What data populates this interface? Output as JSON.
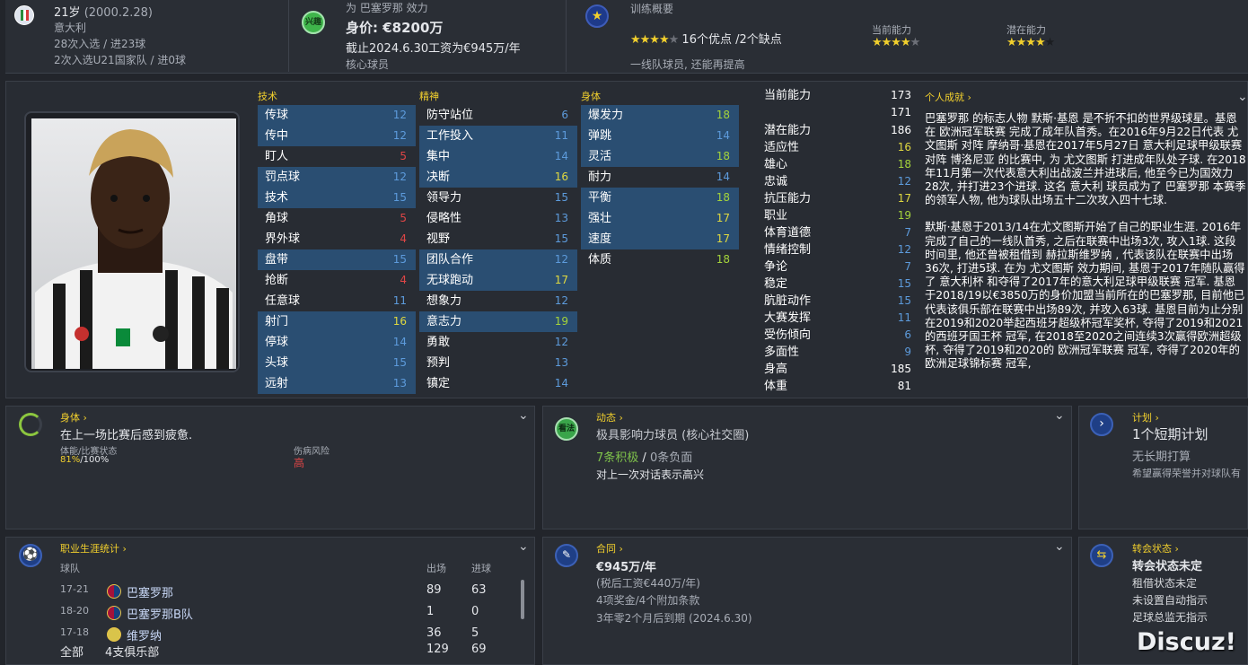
{
  "header": {
    "age": "21岁",
    "dob": "(2000.2.28)",
    "nation": "意大利",
    "caps": "28次入选 / 进23球",
    "u21": "2次入选U21国家队 / 进0球",
    "club_line": "为 巴塞罗那 效力",
    "club_icon_text": "兴趣",
    "value": "身价: €8200万",
    "wage_line": "截止2024.6.30工资为€945万/年",
    "role": "核心球员",
    "training_title": "训练概要",
    "training_summary": "16个优点 /2个缺点",
    "training_note": "一线队球员, 还能再提高",
    "ca_label": "当前能力",
    "pa_label": "潜在能力"
  },
  "attributes": {
    "tech_title": "技术",
    "mental_title": "精神",
    "physical_title": "身体",
    "technical": [
      {
        "name": "传球",
        "value": "12"
      },
      {
        "name": "传中",
        "value": "12"
      },
      {
        "name": "盯人",
        "value": "5"
      },
      {
        "name": "罚点球",
        "value": "12"
      },
      {
        "name": "技术",
        "value": "15"
      },
      {
        "name": "角球",
        "value": "5"
      },
      {
        "name": "界外球",
        "value": "4"
      },
      {
        "name": "盘带",
        "value": "15"
      },
      {
        "name": "抢断",
        "value": "4"
      },
      {
        "name": "任意球",
        "value": "11"
      },
      {
        "name": "射门",
        "value": "16"
      },
      {
        "name": "停球",
        "value": "14"
      },
      {
        "name": "头球",
        "value": "15"
      },
      {
        "name": "远射",
        "value": "13"
      }
    ],
    "mental": [
      {
        "name": "防守站位",
        "value": "6"
      },
      {
        "name": "工作投入",
        "value": "11"
      },
      {
        "name": "集中",
        "value": "14"
      },
      {
        "name": "决断",
        "value": "16"
      },
      {
        "name": "领导力",
        "value": "15"
      },
      {
        "name": "侵略性",
        "value": "13"
      },
      {
        "name": "视野",
        "value": "15"
      },
      {
        "name": "团队合作",
        "value": "12"
      },
      {
        "name": "无球跑动",
        "value": "17"
      },
      {
        "name": "想象力",
        "value": "12"
      },
      {
        "name": "意志力",
        "value": "19"
      },
      {
        "name": "勇敢",
        "value": "12"
      },
      {
        "name": "预判",
        "value": "13"
      },
      {
        "name": "镇定",
        "value": "14"
      }
    ],
    "physical": [
      {
        "name": "爆发力",
        "value": "18"
      },
      {
        "name": "弹跳",
        "value": "14"
      },
      {
        "name": "灵活",
        "value": "18"
      },
      {
        "name": "耐力",
        "value": "14"
      },
      {
        "name": "平衡",
        "value": "18"
      },
      {
        "name": "强壮",
        "value": "17"
      },
      {
        "name": "速度",
        "value": "17"
      },
      {
        "name": "体质",
        "value": "18"
      }
    ]
  },
  "player_stats": [
    {
      "name": "当前能力",
      "value": "173"
    },
    {
      "name": "",
      "value": "171"
    },
    {
      "name": "潜在能力",
      "value": "186"
    },
    {
      "name": "适应性",
      "value": "16"
    },
    {
      "name": "雄心",
      "value": "18"
    },
    {
      "name": "忠诚",
      "value": "12"
    },
    {
      "name": "抗压能力",
      "value": "17"
    },
    {
      "name": "职业",
      "value": "19"
    },
    {
      "name": "体育道德",
      "value": "7"
    },
    {
      "name": "情绪控制",
      "value": "12"
    },
    {
      "name": "争论",
      "value": "7"
    },
    {
      "name": "稳定",
      "value": "15"
    },
    {
      "name": "肮脏动作",
      "value": "15"
    },
    {
      "name": "大赛发挥",
      "value": "11"
    },
    {
      "name": "受伤倾向",
      "value": "6"
    },
    {
      "name": "多面性",
      "value": "9"
    },
    {
      "name": "身高",
      "value": "185"
    },
    {
      "name": "体重",
      "value": "81"
    }
  ],
  "bio": {
    "title": "个人成就 ›",
    "p1": "巴塞罗那 的标志人物 默斯·基恩 是不折不扣的世界级球星。基恩 在 欧洲冠军联赛 完成了成年队首秀。在2016年9月22日代表 尤文图斯 对阵 摩纳哥·基恩在2017年5月27日 意大利足球甲级联赛 对阵 博洛尼亚 的比赛中, 为 尤文图斯 打进成年队处子球. 在2018年11月第一次代表意大利出战波兰并进球后, 他至今已为国效力28次, 并打进23个进球. 这名 意大利 球员成为了 巴塞罗那 本赛季的领军人物, 他为球队出场五十二次攻入四十七球.",
    "p2": "默斯·基恩于2013/14在尤文图斯开始了自己的职业生涯. 2016年完成了自己的一线队首秀, 之后在联赛中出场3次, 攻入1球. 这段时间里, 他还曾被租借到 赫拉斯维罗纳 , 代表该队在联赛中出场36次, 打进5球. 在为 尤文图斯 效力期间, 基恩于2017年随队赢得了 意大利杯 和夺得了2017年的意大利足球甲级联赛 冠军. 基恩于2018/19以€3850万的身价加盟当前所在的巴塞罗那, 目前他已代表该俱乐部在联赛中出场89次, 并攻入63球. 基恩目前为止分别在2019和2020举起西班牙超级杯冠军奖杯, 夺得了2019和2021的西班牙国王杯 冠军, 在2018至2020之间连续3次赢得欧洲超级杯, 夺得了2019和2020的 欧洲冠军联赛 冠军, 夺得了2020年的 欧洲足球锦标赛 冠军,"
  },
  "fitness": {
    "title": "身体 ›",
    "headline": "在上一场比赛后感到疲惫.",
    "cond_label": "体能/比赛状态",
    "cond_value": "81%",
    "cond_suffix": "/100%",
    "injury_label": "伤病风险",
    "injury_value": "高"
  },
  "dynamics": {
    "title": "动态 ›",
    "icon_text": "看法",
    "headline": "极具影响力球员 (核心社交圈)",
    "positive": "7条积极",
    "sep": " / ",
    "negative": "0条负面",
    "note": "对上一次对话表示高兴"
  },
  "plan": {
    "title": "计划 ›",
    "headline": "1个短期计划",
    "sub": "无长期打算",
    "note": "希望赢得荣誉并对球队有"
  },
  "career": {
    "title": "职业生涯统计 ›",
    "col_club": "球队",
    "col_apps": "出场",
    "col_goals": "进球",
    "rows": [
      {
        "years": "17-21",
        "club": "巴塞罗那",
        "apps": "89",
        "goals": "63"
      },
      {
        "years": "18-20",
        "club": "巴塞罗那B队",
        "apps": "1",
        "goals": "0"
      },
      {
        "years": "17-18",
        "club": "维罗纳",
        "apps": "36",
        "goals": "5"
      }
    ],
    "total_label": "全部",
    "total_clubs": "4支俱乐部",
    "total_apps": "129",
    "total_goals": "69"
  },
  "contract": {
    "title": "合同 ›",
    "wage": "€945万/年",
    "pre_tax": "(税后工资€440万/年)",
    "bonus": "4项奖金/4个附加条款",
    "expiry": "3年零2个月后到期 (2024.6.30)"
  },
  "transfer": {
    "title": "转会状态 ›",
    "headline": "转会状态未定",
    "l1": "租借状态未定",
    "l2": "未设置自动指示",
    "l3": "足球总监无指示"
  },
  "watermark": "Discuz!",
  "colors": {
    "accent": "#f1cf2d",
    "blue": "#5d9bdc",
    "red": "#e04646",
    "green": "#a4d33b",
    "highlight": "#2a4e72"
  }
}
